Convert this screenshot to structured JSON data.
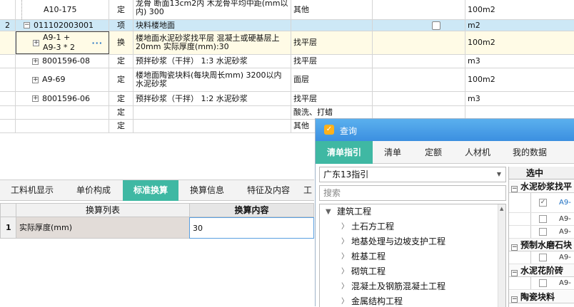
{
  "grid": {
    "rows": [
      {
        "num": "",
        "code": "A10-175",
        "type": "定",
        "name": "龙骨 断面13cm2内 木龙骨平均中距(mm以内) 300",
        "spec": "其他",
        "flag": "",
        "unit": "100m2"
      },
      {
        "num": "2",
        "code": "011102003001",
        "type": "项",
        "name": "块料楼地面",
        "spec": "",
        "flag": "checkbox",
        "unit": "m2"
      },
      {
        "num": "",
        "code": "A9-1 + A9-3 * 2",
        "type": "换",
        "name": "楼地面水泥砂浆找平层 混凝土或硬基层上 20mm  实际厚度(mm):30",
        "spec": "找平层",
        "flag": "",
        "unit": "100m2"
      },
      {
        "num": "",
        "code": "8001596-08",
        "type": "定",
        "name": "预拌砂浆（干拌） 1:3 水泥砂浆",
        "spec": "找平层",
        "flag": "",
        "unit": "m3"
      },
      {
        "num": "",
        "code": "A9-69",
        "type": "定",
        "name": "楼地面陶瓷块料(每块周长mm) 3200以内 水泥砂浆",
        "spec": "面层",
        "flag": "",
        "unit": "100m2"
      },
      {
        "num": "",
        "code": "8001596-06",
        "type": "定",
        "name": "预拌砂浆（干拌） 1:2 水泥砂浆",
        "spec": "找平层",
        "flag": "",
        "unit": "m3"
      },
      {
        "num": "",
        "code": "",
        "type": "定",
        "name": "",
        "spec": "酸洗、打蜡",
        "flag": "",
        "unit": ""
      },
      {
        "num": "",
        "code": "",
        "type": "定",
        "name": "",
        "spec": "其他",
        "flag": "",
        "unit": ""
      }
    ],
    "row2_code_line1": "A9-1 +",
    "row2_code_line2": "A9-3 * 2",
    "ellipsis": "···"
  },
  "tabs": [
    "工料机显示",
    "单价构成",
    "标准换算",
    "换算信息",
    "特征及内容",
    "工"
  ],
  "active_tab": "标准换算",
  "convert": {
    "col_list": "换算列表",
    "col_content": "换算内容",
    "rows": [
      {
        "num": "1",
        "label": "实际厚度(mm)",
        "value": "30"
      }
    ]
  },
  "dialog": {
    "title": "查询",
    "logo_glyph": "✓",
    "tabs": [
      "清单指引",
      "清单",
      "定额",
      "人材机",
      "我的数据"
    ],
    "active_tab": "清单指引",
    "select_value": "广东13指引",
    "search_placeholder": "搜索",
    "tree": {
      "root": "建筑工程",
      "children": [
        "土石方工程",
        "地基处理与边坡支护工程",
        "桩基工程",
        "砌筑工程",
        "混凝土及钢筋混凝土工程",
        "金属结构工程"
      ]
    },
    "result": {
      "header": "选中",
      "groups": [
        {
          "label": "水泥砂浆找平"
        },
        {
          "label": "预制水磨石块"
        },
        {
          "label": "水泥花阶砖"
        },
        {
          "label": "陶瓷块料"
        }
      ],
      "items": [
        {
          "code": "A9-",
          "checked": true
        },
        {
          "code": "A9-",
          "checked": false
        },
        {
          "code": "A9-",
          "checked": false
        },
        {
          "code": "A9-",
          "checked": false
        },
        {
          "code": "A9-",
          "checked": false
        }
      ]
    }
  },
  "colors": {
    "accent": "#3fb8a3",
    "selected_row": "#cde8f6",
    "title_bar": "#3c8fe0",
    "link": "#1d6fc2"
  }
}
